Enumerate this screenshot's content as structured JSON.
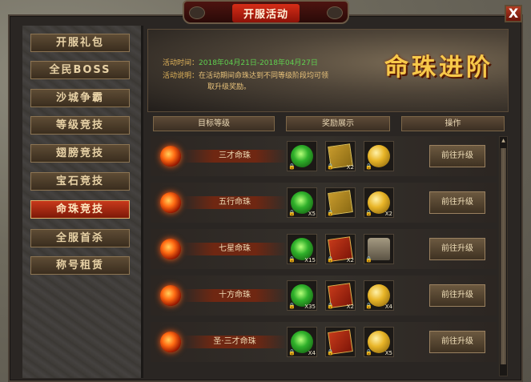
{
  "window": {
    "title": "开服活动",
    "close_glyph": "X"
  },
  "sidebar": {
    "items": [
      {
        "label": "开服礼包",
        "active": false
      },
      {
        "label": "全民BOSS",
        "active": false
      },
      {
        "label": "沙城争霸",
        "active": false
      },
      {
        "label": "等级竞技",
        "active": false
      },
      {
        "label": "翅膀竞技",
        "active": false
      },
      {
        "label": "宝石竞技",
        "active": false
      },
      {
        "label": "命珠竞技",
        "active": true
      },
      {
        "label": "全服首杀",
        "active": false
      },
      {
        "label": "称号租赁",
        "active": false
      }
    ]
  },
  "header": {
    "time_label": "活动时间：",
    "time_value": "2018年04月21日-2018年04月27日",
    "desc_label": "活动说明：",
    "desc_line1": "在活动期间命珠达到不同等级阶段均可领",
    "desc_line2": "取升级奖励。",
    "big_title": "命珠进阶"
  },
  "columns": {
    "target": "目标等级",
    "rewards": "奖励展示",
    "action": "操作"
  },
  "rows": [
    {
      "name": "三才命珠",
      "action": "前往升级",
      "rewards": [
        {
          "icon": "green-orb-icon",
          "qty": ""
        },
        {
          "icon": "gold-book-icon",
          "qty": "X2"
        },
        {
          "icon": "gold-ball-icon",
          "qty": ""
        }
      ]
    },
    {
      "name": "五行命珠",
      "action": "前往升级",
      "rewards": [
        {
          "icon": "green-orb-icon",
          "qty": "X5"
        },
        {
          "icon": "gold-book-icon",
          "qty": ""
        },
        {
          "icon": "gold-ball-icon",
          "qty": "X2"
        }
      ]
    },
    {
      "name": "七星命珠",
      "action": "前往升级",
      "rewards": [
        {
          "icon": "green-orb-icon",
          "qty": "X15"
        },
        {
          "icon": "red-book-icon",
          "qty": "X2"
        },
        {
          "icon": "statue-icon",
          "qty": ""
        }
      ]
    },
    {
      "name": "十方命珠",
      "action": "前往升级",
      "rewards": [
        {
          "icon": "green-orb-icon",
          "qty": "X35"
        },
        {
          "icon": "red-book-icon",
          "qty": "X2"
        },
        {
          "icon": "gold-ball-icon",
          "qty": "X4"
        }
      ]
    },
    {
      "name": "圣·三才命珠",
      "action": "前往升级",
      "rewards": [
        {
          "icon": "green-orb-icon",
          "qty": "X4"
        },
        {
          "icon": "red-book-icon",
          "qty": ""
        },
        {
          "icon": "gold-ball-icon",
          "qty": "X5"
        }
      ]
    }
  ],
  "lock_glyph": "🔒",
  "scroll_up_glyph": "▲"
}
